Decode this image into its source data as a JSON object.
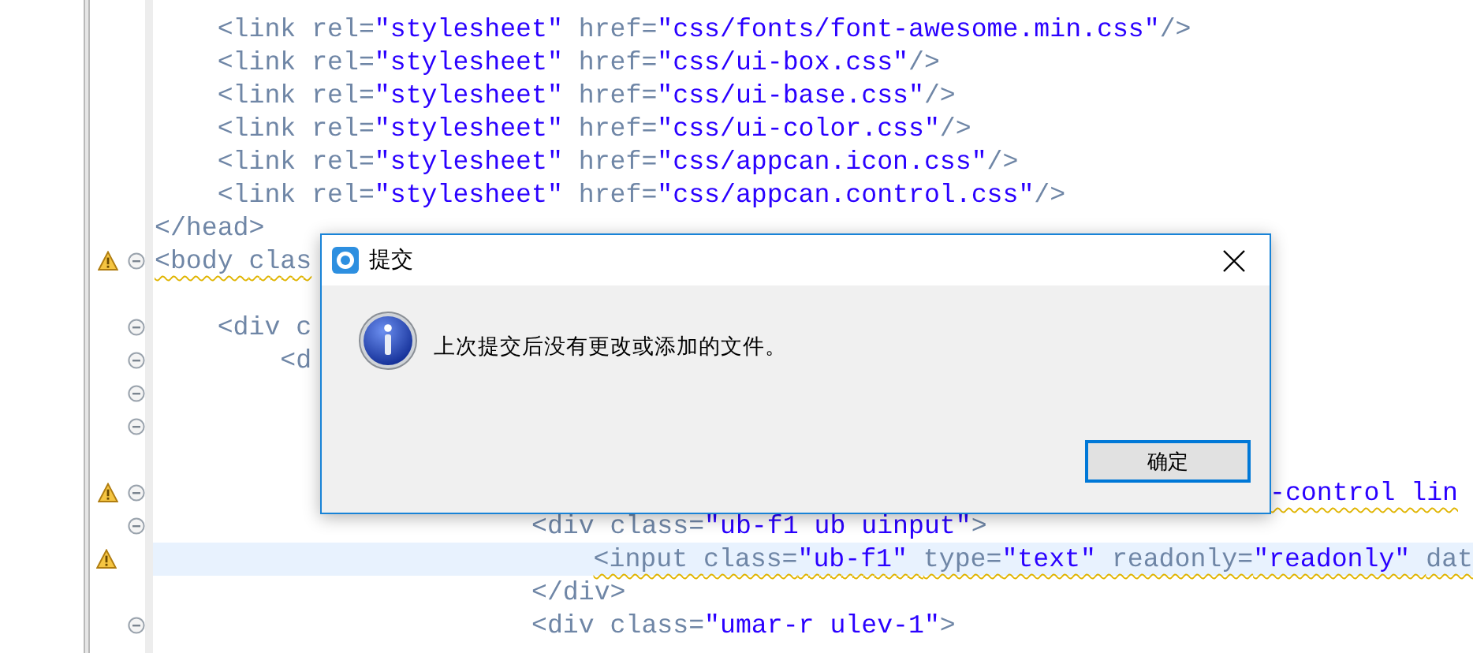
{
  "editor": {
    "lines": [
      {
        "segments": [
          {
            "kind": "tag",
            "text": "<link "
          },
          {
            "kind": "attr",
            "text": "rel="
          },
          {
            "kind": "value",
            "text": "\"stylesheet\" "
          },
          {
            "kind": "attr",
            "text": "href="
          },
          {
            "kind": "value",
            "text": "\"css/fonts/font-awesome.min.css\""
          },
          {
            "kind": "tag",
            "text": "/>"
          }
        ],
        "warning": false,
        "fold": false,
        "highlighted": false
      },
      {
        "segments": [
          {
            "kind": "tag",
            "text": "<link "
          },
          {
            "kind": "attr",
            "text": "rel="
          },
          {
            "kind": "value",
            "text": "\"stylesheet\" "
          },
          {
            "kind": "attr",
            "text": "href="
          },
          {
            "kind": "value",
            "text": "\"css/ui-box.css\""
          },
          {
            "kind": "tag",
            "text": "/>"
          }
        ],
        "warning": false,
        "fold": false,
        "highlighted": false
      },
      {
        "segments": [
          {
            "kind": "tag",
            "text": "<link "
          },
          {
            "kind": "attr",
            "text": "rel="
          },
          {
            "kind": "value",
            "text": "\"stylesheet\" "
          },
          {
            "kind": "attr",
            "text": "href="
          },
          {
            "kind": "value",
            "text": "\"css/ui-base.css\""
          },
          {
            "kind": "tag",
            "text": "/>"
          }
        ],
        "warning": false,
        "fold": false,
        "highlighted": false
      },
      {
        "segments": [
          {
            "kind": "tag",
            "text": "<link "
          },
          {
            "kind": "attr",
            "text": "rel="
          },
          {
            "kind": "value",
            "text": "\"stylesheet\" "
          },
          {
            "kind": "attr",
            "text": "href="
          },
          {
            "kind": "value",
            "text": "\"css/ui-color.css\""
          },
          {
            "kind": "tag",
            "text": "/>"
          }
        ],
        "warning": false,
        "fold": false,
        "highlighted": false
      },
      {
        "segments": [
          {
            "kind": "tag",
            "text": "<link "
          },
          {
            "kind": "attr",
            "text": "rel="
          },
          {
            "kind": "value",
            "text": "\"stylesheet\" "
          },
          {
            "kind": "attr",
            "text": "href="
          },
          {
            "kind": "value",
            "text": "\"css/appcan.icon.css\""
          },
          {
            "kind": "tag",
            "text": "/>"
          }
        ],
        "warning": false,
        "fold": false,
        "highlighted": false
      },
      {
        "segments": [
          {
            "kind": "tag",
            "text": "<link "
          },
          {
            "kind": "attr",
            "text": "rel="
          },
          {
            "kind": "value",
            "text": "\"stylesheet\" "
          },
          {
            "kind": "attr",
            "text": "href="
          },
          {
            "kind": "value",
            "text": "\"css/appcan.control.css\""
          },
          {
            "kind": "tag",
            "text": "/>"
          }
        ],
        "warning": false,
        "fold": false,
        "highlighted": false
      },
      {
        "segments": [
          {
            "kind": "tag",
            "text": "</head>"
          }
        ],
        "warning": false,
        "fold": false,
        "highlighted": false
      },
      {
        "segments": [
          {
            "kind": "tag",
            "text": "<body "
          },
          {
            "kind": "attr",
            "text": "clas"
          }
        ],
        "warning": true,
        "fold": true,
        "highlighted": false
      },
      {
        "warning": false,
        "fold": false,
        "highlighted": false
      },
      {
        "segments": [
          {
            "kind": "tag",
            "text": "<div "
          },
          {
            "kind": "attr",
            "text": "c"
          }
        ],
        "warning": false,
        "fold": true,
        "highlighted": false
      },
      {
        "segments": [
          {
            "kind": "tag",
            "text": "<d"
          }
        ],
        "warning": false,
        "fold": true,
        "highlighted": false
      },
      {
        "warning": false,
        "fold": true,
        "highlighted": false
      },
      {
        "warning": false,
        "fold": true,
        "highlighted": false
      },
      {
        "warning": false,
        "fold": false,
        "highlighted": false
      },
      {
        "segments": [
          {
            "kind": "value",
            "text": "-control lin"
          }
        ],
        "warning": true,
        "fold": true,
        "highlighted": false
      },
      {
        "segments": [
          {
            "kind": "tag",
            "text": "<div "
          },
          {
            "kind": "attr",
            "text": "class="
          },
          {
            "kind": "value",
            "text": "\"ub-f1 ub uinput\""
          },
          {
            "kind": "tag",
            "text": ">"
          }
        ],
        "warning": false,
        "fold": true,
        "highlighted": false
      },
      {
        "segments": [
          {
            "kind": "tag",
            "text": "<input "
          },
          {
            "kind": "attr",
            "text": "class="
          },
          {
            "kind": "value",
            "text": "\"ub-f1\" "
          },
          {
            "kind": "attr",
            "text": "type="
          },
          {
            "kind": "value",
            "text": "\"text\" "
          },
          {
            "kind": "attr",
            "text": "readonly="
          },
          {
            "kind": "value",
            "text": "\"readonly\" "
          },
          {
            "kind": "attr",
            "text": "dat"
          }
        ],
        "warning": true,
        "fold": false,
        "highlighted": true
      },
      {
        "segments": [
          {
            "kind": "tag",
            "text": "</div>"
          }
        ],
        "warning": false,
        "fold": false,
        "highlighted": false
      },
      {
        "segments": [
          {
            "kind": "tag",
            "text": "<div "
          },
          {
            "kind": "attr",
            "text": "class="
          },
          {
            "kind": "value",
            "text": "\"umar-r ulev-1\""
          },
          {
            "kind": "tag",
            "text": ">"
          }
        ],
        "warning": false,
        "fold": true,
        "highlighted": false
      }
    ]
  },
  "dialog": {
    "title": "提交",
    "message": "上次提交后没有更改或添加的文件。",
    "buttons": [
      {
        "label": "确定",
        "focused": true
      }
    ]
  }
}
